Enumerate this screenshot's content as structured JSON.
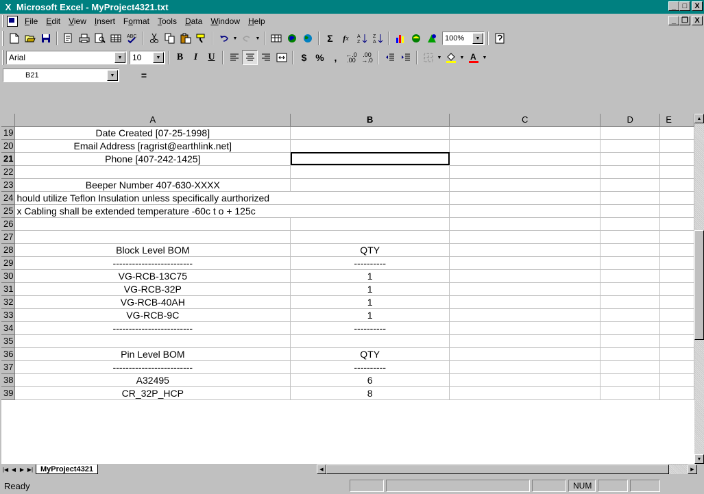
{
  "window": {
    "title": "Microsoft Excel - MyProject4321.txt",
    "minimize": "_",
    "maximize": "□",
    "close": "X"
  },
  "menu": {
    "items": [
      {
        "label": "File"
      },
      {
        "label": "Edit"
      },
      {
        "label": "View"
      },
      {
        "label": "Insert"
      },
      {
        "label": "Format"
      },
      {
        "label": "Tools"
      },
      {
        "label": "Data"
      },
      {
        "label": "Window"
      },
      {
        "label": "Help"
      }
    ]
  },
  "toolbar_standard": {
    "zoom": "100%"
  },
  "toolbar_format": {
    "font": "Arial",
    "size": "10"
  },
  "formula_bar": {
    "name_box": "B21",
    "equals": "=",
    "content": ""
  },
  "columns": [
    "A",
    "B",
    "C",
    "D",
    "E"
  ],
  "active_cell": "B21",
  "rows": [
    {
      "num": "19",
      "a": "Date Created [07-25-1998]",
      "b": ""
    },
    {
      "num": "20",
      "a": "Email Address [ragrist@earthlink.net]",
      "b": ""
    },
    {
      "num": "21",
      "a": "Phone [407-242-1425]",
      "b": ""
    },
    {
      "num": "22",
      "a": "",
      "b": ""
    },
    {
      "num": "23",
      "a": "Beeper Number 407-630-XXXX",
      "b": ""
    },
    {
      "num": "24",
      "a": "hould utilize Teflon Insulation unless specifically aurthorized",
      "b": ""
    },
    {
      "num": "25",
      "a": "x Cabling shall be extended  temperature -60c t o + 125c",
      "b": ""
    },
    {
      "num": "26",
      "a": "",
      "b": ""
    },
    {
      "num": "27",
      "a": "",
      "b": ""
    },
    {
      "num": "28",
      "a": "Block Level BOM",
      "b": "QTY"
    },
    {
      "num": "29",
      "a": "-------------------------",
      "b": "----------"
    },
    {
      "num": "30",
      "a": "VG-RCB-13C75",
      "b": "1"
    },
    {
      "num": "31",
      "a": "VG-RCB-32P",
      "b": "1"
    },
    {
      "num": "32",
      "a": "VG-RCB-40AH",
      "b": "1"
    },
    {
      "num": "33",
      "a": "VG-RCB-9C",
      "b": "1"
    },
    {
      "num": "34",
      "a": "-------------------------",
      "b": "----------"
    },
    {
      "num": "35",
      "a": "",
      "b": ""
    },
    {
      "num": "36",
      "a": "Pin Level BOM",
      "b": "QTY"
    },
    {
      "num": "37",
      "a": "-------------------------",
      "b": "----------"
    },
    {
      "num": "38",
      "a": "A32495",
      "b": "6"
    },
    {
      "num": "39",
      "a": "CR_32P_HCP",
      "b": "8"
    }
  ],
  "sheet_tab": "MyProject4321",
  "status": {
    "text": "Ready",
    "num": "NUM"
  }
}
